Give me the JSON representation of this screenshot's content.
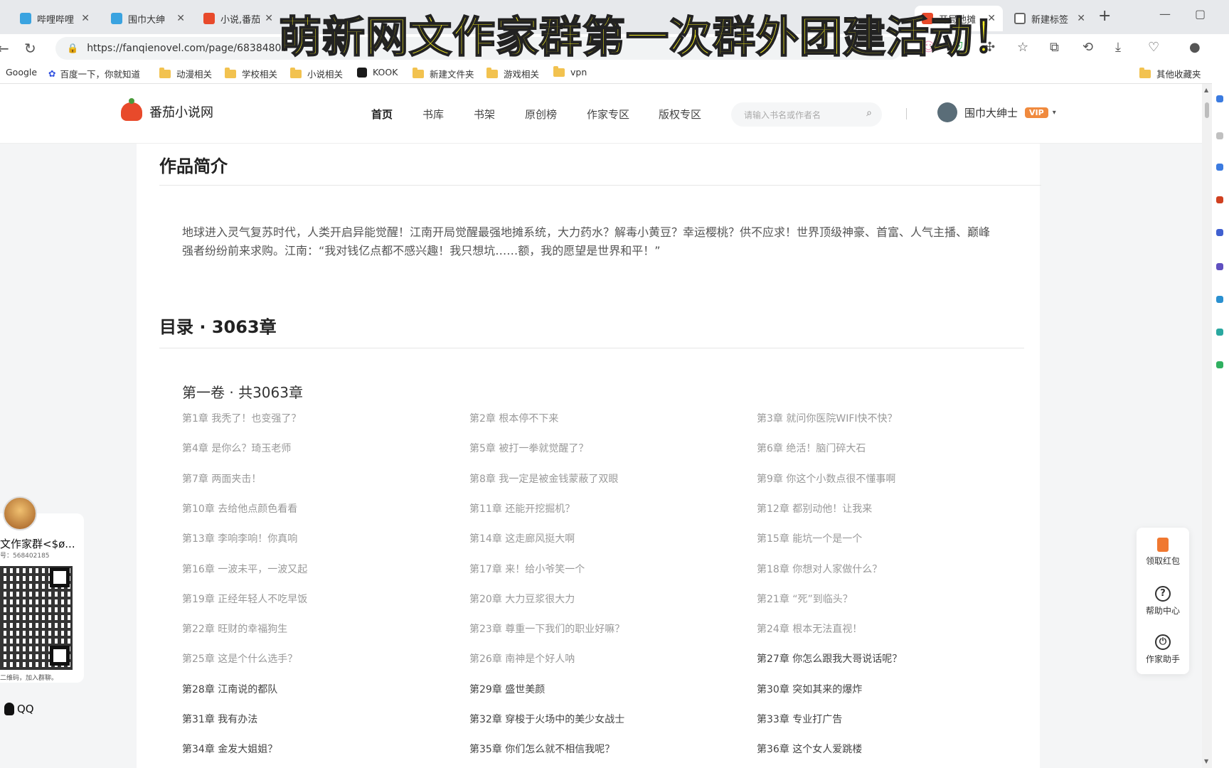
{
  "overlay_caption": "萌新网文作家群第一次群外团建活动！",
  "browser": {
    "tabs": [
      {
        "label": "哔哩哔哩",
        "color": "#3aa3e0"
      },
      {
        "label": "围巾大绅",
        "color": "#3aa3e0"
      },
      {
        "label": "小说,番茄",
        "color": "#e84a2b"
      },
      {
        "label": "开局地摊",
        "color": "#e84a2b",
        "active": true
      },
      {
        "label": "新建标签",
        "color": "#888888"
      }
    ],
    "url": "https://fanqienovel.com/page/68384800",
    "bookmarks": [
      "Google",
      "百度一下，你就知道",
      "动漫相关",
      "学校相关",
      "小说相关",
      "KOOK",
      "新建文件夹",
      "游戏相关",
      "vpn",
      "其他收藏夹"
    ]
  },
  "site": {
    "logo": "番茄小说网",
    "nav": [
      "首页",
      "书库",
      "书架",
      "原创榜",
      "作家专区",
      "版权专区"
    ],
    "search_placeholder": "请输入书名或作者名",
    "username": "围巾大绅士",
    "vip": "VIP"
  },
  "book": {
    "intro_title": "作品简介",
    "synopsis": "地球进入灵气复苏时代，人类开启异能觉醒！江南开局觉醒最强地摊系统，大力药水？解毒小黄豆？幸运樱桃？供不应求！世界顶级神豪、首富、人气主播、巅峰强者纷纷前来求购。江南：“我对钱亿点都不感兴趣！我只想坑……额，我的愿望是世界和平！”",
    "toc_title": "目录 · 3063章",
    "volume_title": "第一卷 · 共3063章",
    "chapters": [
      "第1章 我秃了！也变强了？",
      "第2章 根本停不下来",
      "第3章 就问你医院WIFI快不快？",
      "第4章 是你么？琦玉老师",
      "第5章 被打一拳就觉醒了？",
      "第6章 绝活！脑门碎大石",
      "第7章 两面夹击！",
      "第8章 我一定是被金钱蒙蔽了双眼",
      "第9章 你这个小数点很不懂事啊",
      "第10章 去给他点颜色看看",
      "第11章 还能开挖掘机？",
      "第12章 都别动他！让我来",
      "第13章 李响李响！你真响",
      "第14章 这走廊风挺大啊",
      "第15章 能坑一个是一个",
      "第16章 一波未平，一波又起",
      "第17章 来！给小爷笑一个",
      "第18章 你想对人家做什么？",
      "第19章 正经年轻人不吃早饭",
      "第20章 大力豆浆很大力",
      "第21章 “死”到临头？",
      "第22章 旺财的幸福狗生",
      "第23章 尊重一下我们的职业好嘛？",
      "第24章 根本无法直视！",
      "第25章 这是个什么选手？",
      "第26章 南神是个好人呐",
      "第27章 你怎么跟我大哥说话呢？",
      "第28章 江南说的都队",
      "第29章 盛世美颜",
      "第30章 突如其来的爆炸",
      "第31章 我有办法",
      "第32章 穿梭于火场中的美少女战士",
      "第33章 专业打广告",
      "第34章 金发大姐姐？",
      "第35章 你们怎么就不相信我呢？",
      "第36章 这个女人爱跳楼"
    ],
    "unread_from_index": 26
  },
  "side_card": {
    "group_title": "文作家群<$ø...",
    "group_no": "号：568402185",
    "qr_caption": "二维码，加入群聊。",
    "qq_label": "QQ"
  },
  "tools": [
    "领取红包",
    "帮助中心",
    "作家助手"
  ]
}
